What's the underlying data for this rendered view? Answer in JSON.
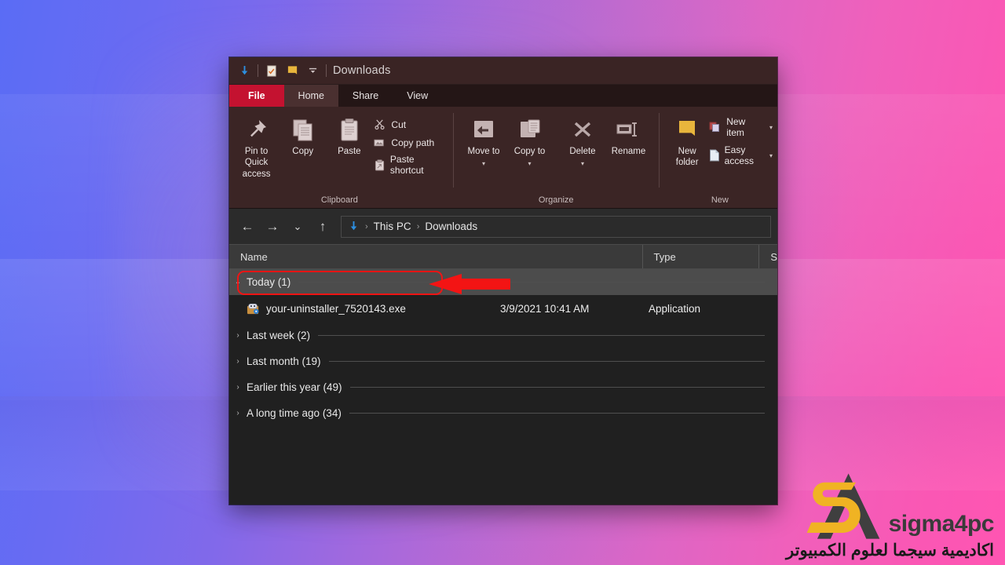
{
  "window": {
    "title": "Downloads",
    "quick_access": [
      "downloads-arrow-icon",
      "properties-icon",
      "new-folder-icon",
      "customize-chevron-icon"
    ]
  },
  "ribbon": {
    "tabs": [
      {
        "label": "File",
        "id": "file"
      },
      {
        "label": "Home",
        "id": "home"
      },
      {
        "label": "Share",
        "id": "share"
      },
      {
        "label": "View",
        "id": "view"
      }
    ],
    "groups": [
      {
        "name": "Clipboard",
        "big_buttons": [
          {
            "label": "Pin to Quick access",
            "icon": "pin-icon"
          },
          {
            "label": "Copy",
            "icon": "copy-icon"
          },
          {
            "label": "Paste",
            "icon": "paste-icon"
          }
        ],
        "small_buttons": [
          {
            "label": "Cut",
            "icon": "scissors-icon"
          },
          {
            "label": "Copy path",
            "icon": "copy-path-icon"
          },
          {
            "label": "Paste shortcut",
            "icon": "paste-shortcut-icon"
          }
        ]
      },
      {
        "name": "Organize",
        "big_buttons": [
          {
            "label": "Move to",
            "icon": "move-to-icon",
            "has_caret": true
          },
          {
            "label": "Copy to",
            "icon": "copy-to-icon",
            "has_caret": true
          },
          {
            "label": "Delete",
            "icon": "delete-x-icon",
            "has_caret": true
          },
          {
            "label": "Rename",
            "icon": "rename-icon"
          }
        ],
        "small_buttons": []
      },
      {
        "name": "New",
        "big_buttons": [
          {
            "label": "New folder",
            "icon": "new-folder-icon"
          }
        ],
        "small_buttons": [
          {
            "label": "New item",
            "icon": "new-item-icon",
            "has_caret": true
          },
          {
            "label": "Easy access",
            "icon": "easy-access-icon",
            "has_caret": true
          }
        ]
      }
    ]
  },
  "navigation": {
    "back": "back-arrow-icon",
    "forward": "forward-arrow-icon",
    "recent": "recent-chevron-icon",
    "up": "up-arrow-icon",
    "breadcrumb_icon": "downloads-arrow-icon",
    "breadcrumbs": [
      "This PC",
      "Downloads"
    ],
    "separator": "›"
  },
  "file_list": {
    "columns": [
      {
        "label": "Name"
      },
      {
        "label": "Type"
      },
      {
        "label": "S"
      }
    ],
    "groups": [
      {
        "label": "Today (1)",
        "expanded": true
      },
      {
        "label": "Last week (2)",
        "expanded": false
      },
      {
        "label": "Last month (19)",
        "expanded": false
      },
      {
        "label": "Earlier this year (49)",
        "expanded": false
      },
      {
        "label": "A long time ago (34)",
        "expanded": false
      }
    ],
    "files": [
      {
        "name": "your-uninstaller_7520143.exe",
        "date": "3/9/2021 10:41 AM",
        "type": "Application",
        "icon": "application-exe-icon",
        "highlighted": true
      }
    ]
  },
  "annotations": {
    "highlight_color": "#f01414",
    "arrow": "left-pointing-red-arrow"
  },
  "watermark": {
    "brand": "sigma4pc",
    "arabic": "اكاديمية سيجما لعلوم الكمبيوتر",
    "logo_gold": "#F0B323",
    "logo_dark": "#3F3F3F"
  }
}
